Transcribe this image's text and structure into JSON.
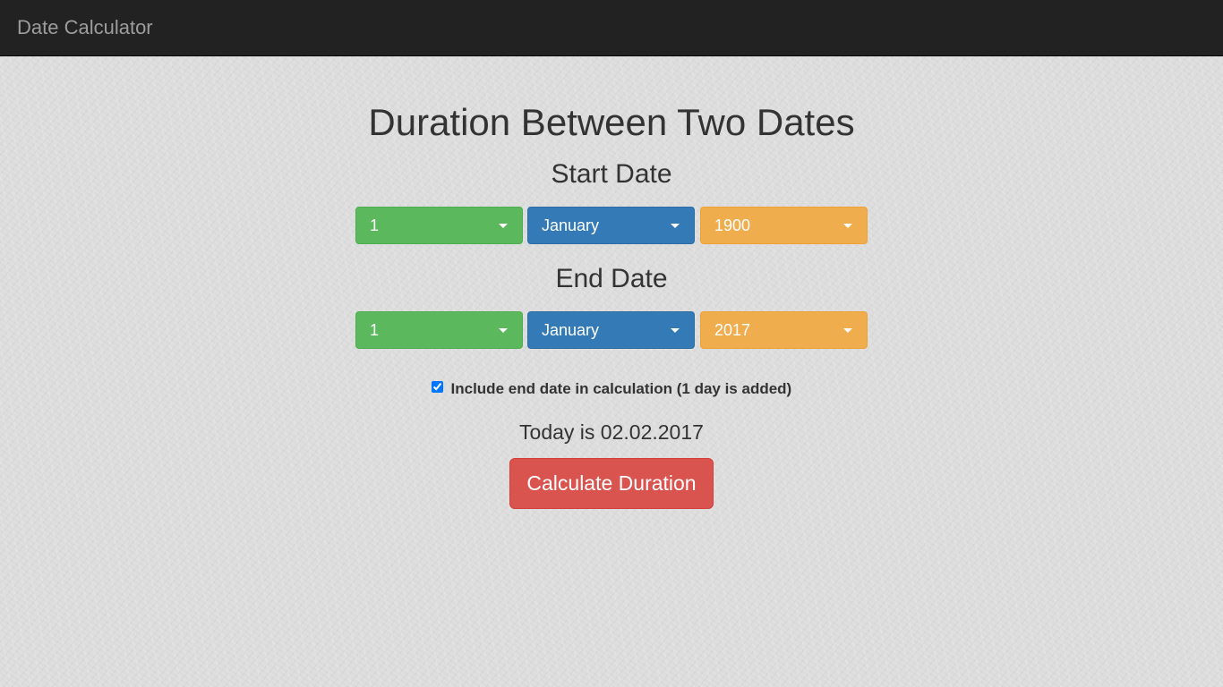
{
  "navbar": {
    "brand": "Date Calculator"
  },
  "main": {
    "title": "Duration Between Two Dates",
    "start_date": {
      "heading": "Start Date",
      "day": "1",
      "month": "January",
      "year": "1900"
    },
    "end_date": {
      "heading": "End Date",
      "day": "1",
      "month": "January",
      "year": "2017"
    },
    "include_end_date": {
      "label": "Include end date in calculation (1 day is added)",
      "checked": true
    },
    "today_text": "Today is 02.02.2017",
    "calculate_button": "Calculate Duration"
  },
  "colors": {
    "navbar_bg": "#222222",
    "day_select": "#5cb85c",
    "month_select": "#337ab7",
    "year_select": "#f0ad4e",
    "calculate_button": "#d9534f"
  },
  "icons": {
    "dropdown": "caret-down-icon"
  }
}
